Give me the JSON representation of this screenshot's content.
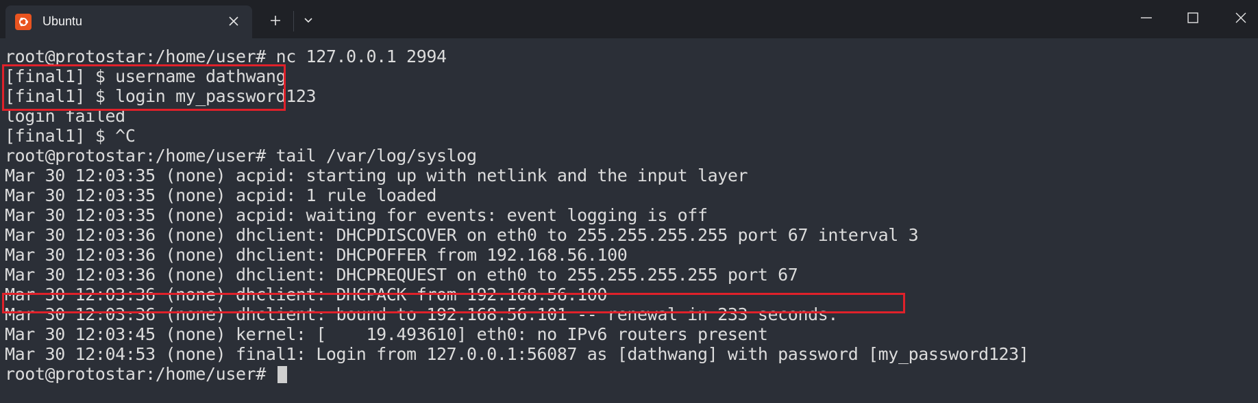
{
  "window": {
    "tab_title": "Ubuntu",
    "icons": {
      "app": "ubuntu-logo-icon",
      "tab_close": "close-icon",
      "new_tab": "plus-icon",
      "dropdown": "chevron-down-icon",
      "minimize": "minimize-icon",
      "maximize": "maximize-icon",
      "close": "close-icon"
    }
  },
  "terminal": {
    "lines": [
      "root@protostar:/home/user# nc 127.0.0.1 2994",
      "[final1] $ username dathwang",
      "[final1] $ login my_password123",
      "login failed",
      "[final1] $ ^C",
      "root@protostar:/home/user# tail /var/log/syslog",
      "Mar 30 12:03:35 (none) acpid: starting up with netlink and the input layer",
      "Mar 30 12:03:35 (none) acpid: 1 rule loaded",
      "Mar 30 12:03:35 (none) acpid: waiting for events: event logging is off",
      "Mar 30 12:03:36 (none) dhclient: DHCPDISCOVER on eth0 to 255.255.255.255 port 67 interval 3",
      "Mar 30 12:03:36 (none) dhclient: DHCPOFFER from 192.168.56.100",
      "Mar 30 12:03:36 (none) dhclient: DHCPREQUEST on eth0 to 255.255.255.255 port 67",
      "Mar 30 12:03:36 (none) dhclient: DHCPACK from 192.168.56.100",
      "Mar 30 12:03:36 (none) dhclient: bound to 192.168.56.101 -- renewal in 233 seconds.",
      "Mar 30 12:03:45 (none) kernel: [    19.493610] eth0: no IPv6 routers present",
      "Mar 30 12:04:53 (none) final1: Login from 127.0.0.1:56087 as [dathwang] with password [my_password123]",
      "root@protostar:/home/user# "
    ]
  },
  "colors": {
    "background": "#2b2f37",
    "titlebar": "#1f2126",
    "text": "#dcdcdc",
    "highlight_box": "#e0212a",
    "ubuntu_orange": "#e95420"
  }
}
